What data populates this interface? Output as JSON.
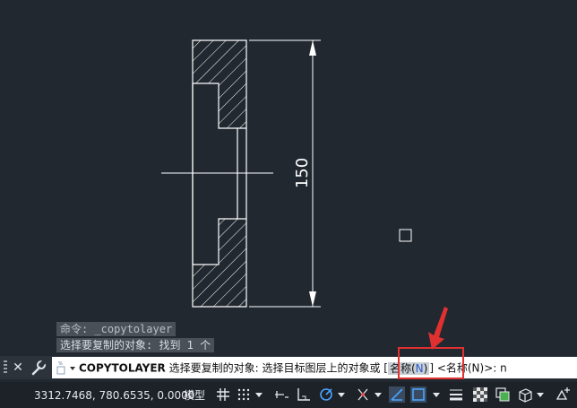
{
  "command_history": [
    "命令: _copytolayer",
    "选择要复制的对象: 找到 1 个"
  ],
  "drawing": {
    "dimension_value": "150"
  },
  "command_line": {
    "command_name": "COPYTOLAYER",
    "prompt_1": " 选择要复制的对象:  选择目标图层上的对象或 [",
    "option_label": "名称(",
    "option_key": "N",
    "option_close": ")",
    "prompt_2": "] <名称(N)>: n"
  },
  "status_bar": {
    "coordinates": "3312.7468, 780.6535, 0.0000",
    "model_label": "模型",
    "icons": [
      "grid-icon",
      "snap-grid-icon",
      "ortho-icon",
      "polar-tracking-icon",
      "object-snap-icon",
      "isodraft-icon",
      "dynamic-ucs-icon",
      "dynamic-input-icon",
      "lineweight-icon",
      "transparency-icon",
      "selection-cycling-icon",
      "3d-osnap-icon",
      "annotation-icon"
    ]
  },
  "colors": {
    "canvas": "#212830",
    "linework": "#ffffff",
    "highlight": "#e03030",
    "option_key": "#2a59c8"
  }
}
